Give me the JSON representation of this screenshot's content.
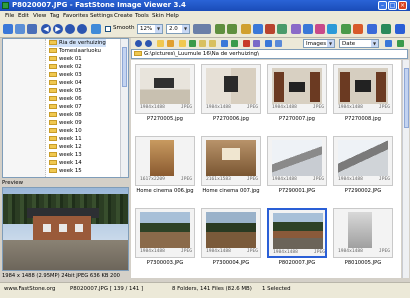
{
  "window": {
    "title": "P8020007.JPG - FastStone Image Viewer 3.4"
  },
  "menu": [
    "File",
    "Edit",
    "View",
    "Tag",
    "Favorites",
    "Settings",
    "Create",
    "Tools",
    "Skin",
    "Help"
  ],
  "toolbar": {
    "smooth_label": "Smooth",
    "zoom_value": "12%",
    "ratio_value": "2.0"
  },
  "tree": {
    "items": [
      "Ria de verhuizing",
      "Tomeslaarluoku",
      "week 01",
      "week 02",
      "week 03",
      "week 04",
      "week 05",
      "week 06",
      "week 07",
      "week 08",
      "week 09",
      "week 10",
      "week 11",
      "week 12",
      "week 13",
      "week 14",
      "week 15"
    ]
  },
  "preview": {
    "label": "Preview",
    "status": "1984 x 1488 (2.95MP)  24bit JPEG  636 KB  200"
  },
  "browser": {
    "filter_value": "Images",
    "sort_value": "Date",
    "path": "G:\\pictures\\_Luumule 16\\Na de verhuizing\\"
  },
  "thumbnails": [
    {
      "name": "P7270005.jpg",
      "dims": "1984x1488",
      "fmt": "JPEG",
      "selected": false
    },
    {
      "name": "P7270006.jpg",
      "dims": "1984x1488",
      "fmt": "JPEG",
      "selected": false
    },
    {
      "name": "P7270007.jpg",
      "dims": "1984x1488",
      "fmt": "JPEG",
      "selected": false
    },
    {
      "name": "P7270008.jpg",
      "dims": "1984x1488",
      "fmt": "JPEG",
      "selected": false
    },
    {
      "name": "Home cinema 006.jpg",
      "dims": "1617x2209",
      "fmt": "JPEG",
      "selected": false
    },
    {
      "name": "Home cinema 007.jpg",
      "dims": "2161x1583",
      "fmt": "JPEG",
      "selected": false
    },
    {
      "name": "P7290001.JPG",
      "dims": "1984x1488",
      "fmt": "JPEG",
      "selected": false
    },
    {
      "name": "P7290002.JPG",
      "dims": "1984x1488",
      "fmt": "JPEG",
      "selected": false
    },
    {
      "name": "P7300003.JPG",
      "dims": "1984x1488",
      "fmt": "JPEG",
      "selected": false
    },
    {
      "name": "P7300004.JPG",
      "dims": "1984x1488",
      "fmt": "JPEG",
      "selected": false
    },
    {
      "name": "P8020007.JPG",
      "dims": "1984x1488",
      "fmt": "JPEG",
      "selected": true
    },
    {
      "name": "P8010005.JPG",
      "dims": "1984x1488",
      "fmt": "JPEG",
      "selected": false
    }
  ],
  "status": {
    "website": "www.FastStone.org",
    "current_file": "P8020007.JPG [ 139 / 141 ]",
    "counts": "8 Folders, 141 Files (82.6 MB)",
    "selection": "1 Selected"
  },
  "colors": {
    "titlebar": "#1a4cb8",
    "selection": "#2a5fd6",
    "folder": "#f0c850"
  }
}
